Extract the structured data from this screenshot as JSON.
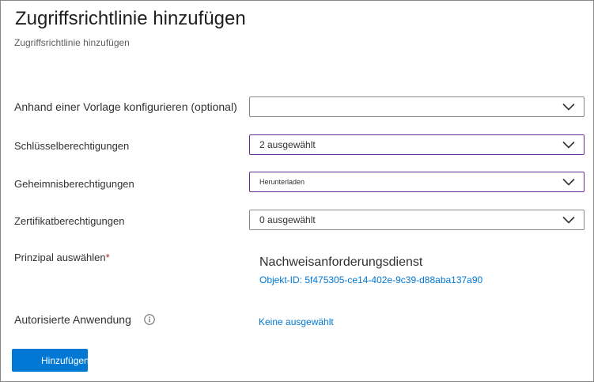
{
  "page": {
    "title": "Zugriffsrichtlinie hinzufügen",
    "subtitle": "Zugriffsrichtlinie hinzufügen"
  },
  "form": {
    "template": {
      "label": "Anhand einer Vorlage konfigurieren (optional)",
      "value": ""
    },
    "key_permissions": {
      "label": "Schlüsselberechtigungen",
      "value": "2 ausgewählt"
    },
    "secret_permissions": {
      "label": "Geheimnisberechtigungen",
      "value": "Herunterladen"
    },
    "certificate_permissions": {
      "label": "Zertifikatberechtigungen",
      "value": "0 ausgewählt"
    },
    "principal": {
      "label": "Prinzipal auswählen",
      "required_marker": "*",
      "name": "Nachweisanforderungsdienst",
      "object_id": "Objekt-ID:  5f475305-ce14-402e-9c39-d88aba137a90"
    },
    "authorized_application": {
      "label": "Autorisierte Anwendung",
      "value": "Keine ausgewählt"
    }
  },
  "actions": {
    "add_label": "Hinzufügen"
  },
  "icons": {
    "dropdown": "chevron-down-icon",
    "info": "info-icon"
  },
  "colors": {
    "accent": "#0078d4",
    "focus_border": "#6b2c91",
    "required": "#a4262c"
  }
}
